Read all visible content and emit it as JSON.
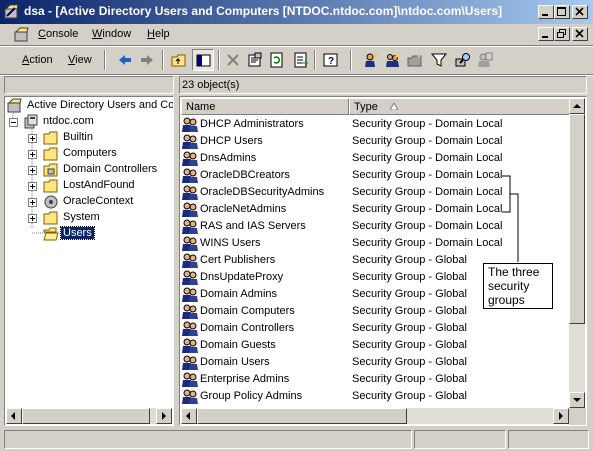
{
  "window": {
    "title": "dsa - [Active Directory Users and Computers [NTDOC.ntdoc.com]\\ntdoc.com\\Users]"
  },
  "menubar": {
    "console": "Console",
    "window": "Window",
    "help": "Help"
  },
  "toolbar": {
    "action": "Action",
    "view": "View"
  },
  "header_bar": {
    "object_count": "23 object(s)"
  },
  "tree": {
    "root": "Active Directory Users and Computers [NTDOC.ntdoc.com]",
    "domain": "ntdoc.com",
    "items": [
      {
        "label": "Builtin"
      },
      {
        "label": "Computers"
      },
      {
        "label": "Domain Controllers"
      },
      {
        "label": "LostAndFound"
      },
      {
        "label": "OracleContext"
      },
      {
        "label": "System"
      },
      {
        "label": "Users"
      }
    ],
    "selected": "Users"
  },
  "list": {
    "columns": [
      "Name",
      "Type"
    ],
    "rows": [
      {
        "name": "DHCP Administrators",
        "type": "Security Group - Domain Local"
      },
      {
        "name": "DHCP Users",
        "type": "Security Group - Domain Local"
      },
      {
        "name": "DnsAdmins",
        "type": "Security Group - Domain Local"
      },
      {
        "name": "OracleDBCreators",
        "type": "Security Group - Domain Local"
      },
      {
        "name": "OracleDBSecurityAdmins",
        "type": "Security Group - Domain Local"
      },
      {
        "name": "OracleNetAdmins",
        "type": "Security Group - Domain Local"
      },
      {
        "name": "RAS and IAS Servers",
        "type": "Security Group - Domain Local"
      },
      {
        "name": "WINS Users",
        "type": "Security Group - Domain Local"
      },
      {
        "name": "Cert Publishers",
        "type": "Security Group - Global"
      },
      {
        "name": "DnsUpdateProxy",
        "type": "Security Group - Global"
      },
      {
        "name": "Domain Admins",
        "type": "Security Group - Global"
      },
      {
        "name": "Domain Computers",
        "type": "Security Group - Global"
      },
      {
        "name": "Domain Controllers",
        "type": "Security Group - Global"
      },
      {
        "name": "Domain Guests",
        "type": "Security Group - Global"
      },
      {
        "name": "Domain Users",
        "type": "Security Group - Global"
      },
      {
        "name": "Enterprise Admins",
        "type": "Security Group - Global"
      },
      {
        "name": "Group Policy Admins",
        "type": "Security Group - Global"
      }
    ]
  },
  "callout": {
    "text": "The three security groups"
  },
  "colors": {
    "titlebar_start": "#0a246a",
    "titlebar_end": "#a6caf0",
    "selection": "#0a246a",
    "face": "#d4d0c8"
  },
  "icons": {
    "app": "dsa-icon",
    "group": "group-icon",
    "folder": "folder-icon",
    "domain": "domain-icon",
    "back": "back-arrow-icon",
    "forward": "forward-arrow-icon"
  }
}
